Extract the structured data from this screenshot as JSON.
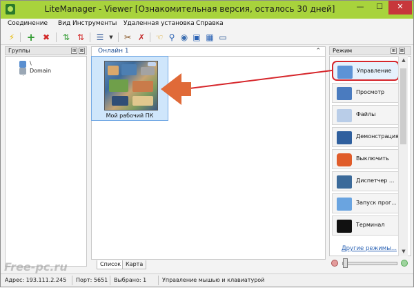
{
  "window": {
    "title": "LiteManager - Viewer [Ознакомительная версия, осталось 30 дней]",
    "minimize_glyph": "—",
    "maximize_glyph": "☐",
    "close_glyph": "✕"
  },
  "menu": {
    "items": [
      "Соединение",
      "Вид",
      "Инструменты",
      "Удаленная установка",
      "Справка"
    ]
  },
  "toolbar": {
    "icons": [
      "connect-lightning-icon",
      "add-green-plus-icon",
      "delete-red-x-icon",
      "refresh-green-arrows-icon",
      "refresh-red-arrows-icon",
      "view-list-icon",
      "dropdown-arrow-icon",
      "tools-icon",
      "cursor-icon",
      "search-icon",
      "dashboard-icon",
      "screen-view-icon",
      "screenshot-icon",
      "monitor-icon"
    ]
  },
  "groups_panel": {
    "title": "Группы",
    "pin_glyph": "⊞",
    "close_glyph": "⊠",
    "tree": {
      "root": "\\",
      "child": "Domain"
    }
  },
  "center_panel": {
    "group_title": "Онлайн 1",
    "collapse_glyph": "⌃",
    "computers": [
      {
        "name": "Мой рабочий ПК"
      }
    ],
    "tabs": [
      {
        "label": "Список",
        "active": true
      },
      {
        "label": "Карта",
        "active": false
      }
    ]
  },
  "mode_panel": {
    "title": "Режим",
    "pin_glyph": "⊞",
    "close_glyph": "⊠",
    "modes": [
      {
        "label": "Управление",
        "icon": "remote-control-icon",
        "active": true
      },
      {
        "label": "Просмотр",
        "icon": "view-screen-icon",
        "active": false
      },
      {
        "label": "Файлы",
        "icon": "files-icon",
        "active": false
      },
      {
        "label": "Демонстрация",
        "icon": "demonstration-icon",
        "active": false
      },
      {
        "label": "Выключить",
        "icon": "power-off-icon",
        "active": false
      },
      {
        "label": "Диспетчер ...",
        "icon": "task-manager-icon",
        "active": false
      },
      {
        "label": "Запуск прог...",
        "icon": "run-program-icon",
        "active": false
      },
      {
        "label": "Терминал",
        "icon": "terminal-icon",
        "active": false
      }
    ],
    "other_modes_link": "Другие режимы...",
    "scroll_up": "▲",
    "scroll_down": "▼",
    "zoom_minus_icon": "zoom-out-icon",
    "zoom_plus_icon": "zoom-in-icon"
  },
  "status_bar": {
    "address": "Адрес: 193.111.2.245",
    "port": "Порт: 5651",
    "selected": "Выбрано: 1",
    "mode_description": "Управление мышью и клавиатурой"
  },
  "watermark": "Free-pc.ru",
  "colors": {
    "titlebar": "#a8d33c",
    "accent_red": "#d6262b",
    "link_blue": "#2a62b4",
    "selection_blue": "#cfe6fb"
  }
}
